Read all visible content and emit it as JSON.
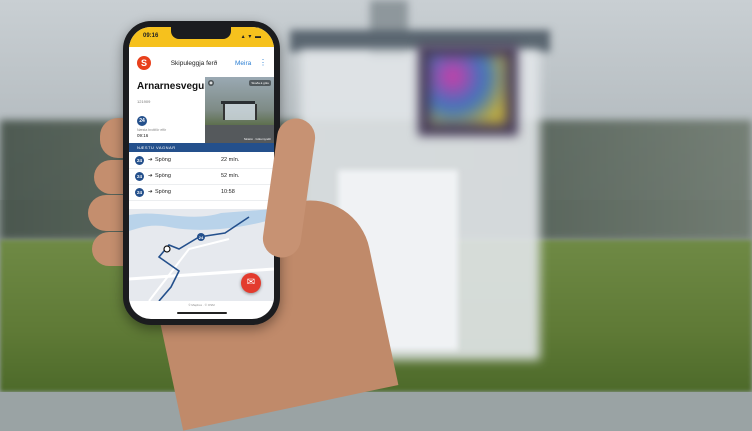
{
  "status_bar": {
    "time": "09:16",
    "icons": "▴ ▾ ▬"
  },
  "header": {
    "logo_letter": "S",
    "title": "Skipuleggja ferð",
    "menu_label": "Meira",
    "menu_icon": "more-vertical-icon"
  },
  "stop": {
    "name": "Arnarnesvegur",
    "code": "121909",
    "route": "24",
    "next_caption": "Næsta brottför eftir",
    "next_time": "09:16"
  },
  "photo": {
    "tag": "Skoða á götu",
    "credit": "Strætó · Götumyndir"
  },
  "departures": {
    "heading": "NÆSTU VAGNAR",
    "rows": [
      {
        "route": "24",
        "destination": "Spöng",
        "time": "22 mín."
      },
      {
        "route": "24",
        "destination": "Spöng",
        "time": "52 mín."
      },
      {
        "route": "24",
        "destination": "Spöng",
        "time": "10:58"
      }
    ]
  },
  "map": {
    "route_badge": "24",
    "attribution": "© Mapbox · © OSM"
  },
  "fab": {
    "icon": "messenger-icon"
  },
  "colors": {
    "brand_yellow": "#f6c11d",
    "brand_blue": "#24508c",
    "logo_red": "#e8401c",
    "link_blue": "#2a7ed3",
    "fab_red": "#e33b2e"
  }
}
